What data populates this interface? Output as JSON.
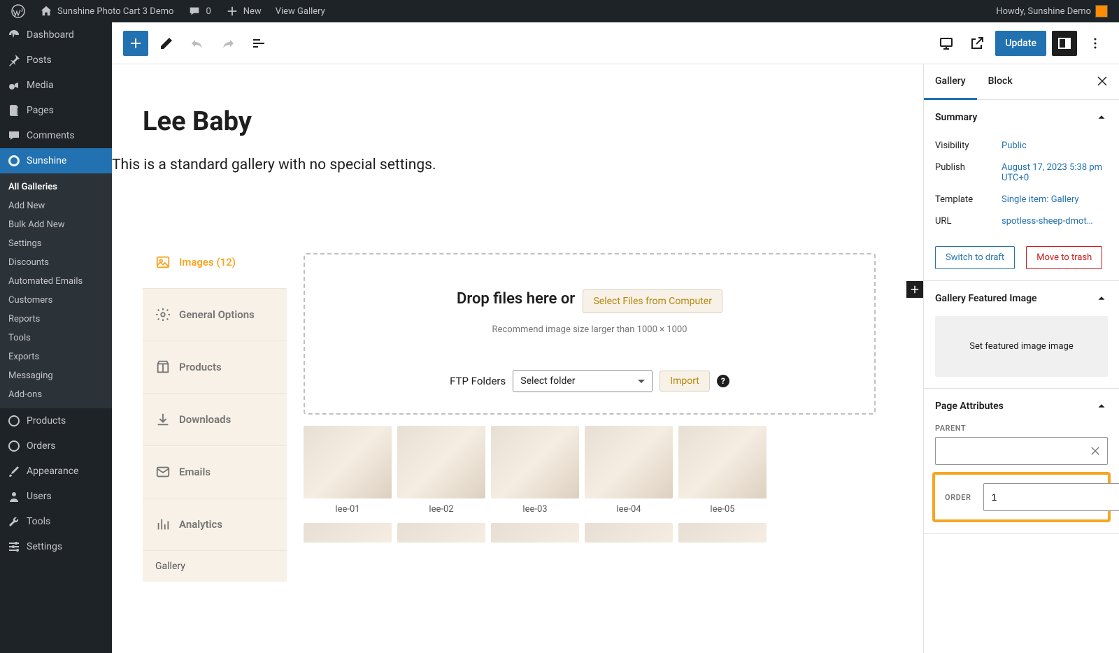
{
  "admin_bar": {
    "site_title": "Sunshine Photo Cart 3 Demo",
    "comments_count": "0",
    "new_label": "New",
    "view_gallery": "View Gallery",
    "howdy": "Howdy, Sunshine Demo"
  },
  "menu": {
    "dashboard": "Dashboard",
    "posts": "Posts",
    "media": "Media",
    "pages": "Pages",
    "comments": "Comments",
    "sunshine": "Sunshine",
    "products": "Products",
    "orders": "Orders",
    "appearance": "Appearance",
    "users": "Users",
    "tools": "Tools",
    "settings": "Settings"
  },
  "submenu": {
    "all_galleries": "All Galleries",
    "add_new": "Add New",
    "bulk_add_new": "Bulk Add New",
    "settings": "Settings",
    "discounts": "Discounts",
    "automated_emails": "Automated Emails",
    "customers": "Customers",
    "reports": "Reports",
    "tools": "Tools",
    "exports": "Exports",
    "messaging": "Messaging",
    "addons": "Add-ons"
  },
  "toolbar": {
    "update_label": "Update"
  },
  "post": {
    "title": "Lee Baby",
    "description": "This is a standard gallery with no special settings."
  },
  "tabs": {
    "images": "Images (12)",
    "general": "General Options",
    "products": "Products",
    "downloads": "Downloads",
    "emails": "Emails",
    "analytics": "Analytics",
    "footer": "Gallery"
  },
  "upload": {
    "drop_text": "Drop files here or",
    "select_button": "Select Files from Computer",
    "hint": "Recommend image size larger than 1000 × 1000",
    "ftp_label": "FTP Folders",
    "ftp_placeholder": "Select folder",
    "import_button": "Import"
  },
  "thumbs": [
    {
      "label": "lee-01"
    },
    {
      "label": "lee-02"
    },
    {
      "label": "lee-03"
    },
    {
      "label": "lee-04"
    },
    {
      "label": "lee-05"
    }
  ],
  "sidebar": {
    "tab_gallery": "Gallery",
    "tab_block": "Block",
    "panels": {
      "summary": "Summary",
      "featured": "Gallery Featured Image",
      "attributes": "Page Attributes"
    },
    "summary": {
      "visibility_label": "Visibility",
      "visibility_value": "Public",
      "publish_label": "Publish",
      "publish_value": "August 17, 2023 5:38 pm UTC+0",
      "template_label": "Template",
      "template_value": "Single item: Gallery",
      "url_label": "URL",
      "url_value": "spotless-sheep-dmot…"
    },
    "actions": {
      "draft": "Switch to draft",
      "trash": "Move to trash"
    },
    "featured_placeholder": "Set featured image image",
    "attributes": {
      "parent_label": "PARENT",
      "order_label": "ORDER",
      "order_value": "1"
    }
  }
}
